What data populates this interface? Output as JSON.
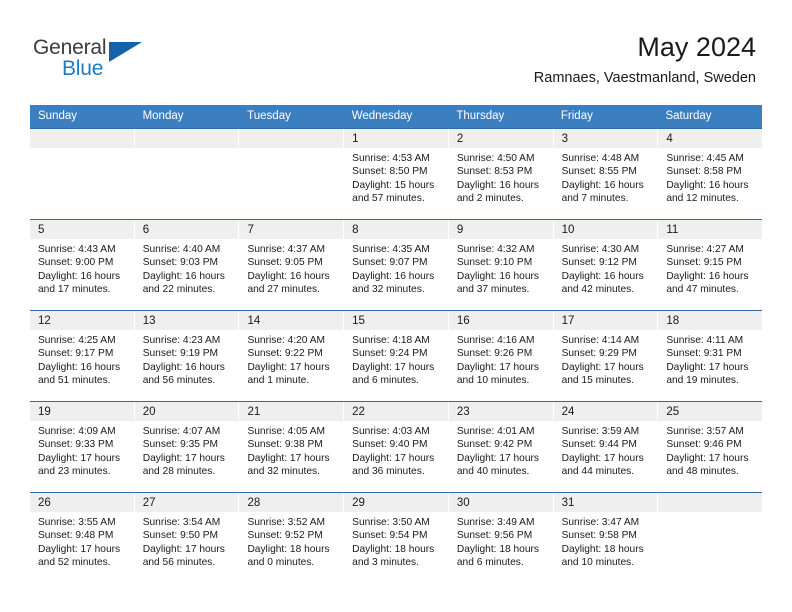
{
  "brand": {
    "name_top": "General",
    "name_bottom": "Blue",
    "triangle_icon": "triangle-icon",
    "colors": {
      "general_text": "#3c3c3c",
      "blue_text": "#1f7bc1",
      "triangle": "#1263a8"
    }
  },
  "header": {
    "title": "May 2024",
    "subtitle": "Ramnaes, Vaestmanland, Sweden"
  },
  "colors": {
    "header_band": "#3c7fc1",
    "row_divider": "#2e6da4",
    "day_number_band": "#efefef",
    "cell_background": "#ffffff"
  },
  "weekdays": [
    "Sunday",
    "Monday",
    "Tuesday",
    "Wednesday",
    "Thursday",
    "Friday",
    "Saturday"
  ],
  "weeks": [
    [
      {
        "day": "",
        "empty": true,
        "sunrise": "",
        "sunset": "",
        "daylight": ""
      },
      {
        "day": "",
        "empty": true,
        "sunrise": "",
        "sunset": "",
        "daylight": ""
      },
      {
        "day": "",
        "empty": true,
        "sunrise": "",
        "sunset": "",
        "daylight": ""
      },
      {
        "day": "1",
        "empty": false,
        "sunrise": "Sunrise: 4:53 AM",
        "sunset": "Sunset: 8:50 PM",
        "daylight": "Daylight: 15 hours and 57 minutes."
      },
      {
        "day": "2",
        "empty": false,
        "sunrise": "Sunrise: 4:50 AM",
        "sunset": "Sunset: 8:53 PM",
        "daylight": "Daylight: 16 hours and 2 minutes."
      },
      {
        "day": "3",
        "empty": false,
        "sunrise": "Sunrise: 4:48 AM",
        "sunset": "Sunset: 8:55 PM",
        "daylight": "Daylight: 16 hours and 7 minutes."
      },
      {
        "day": "4",
        "empty": false,
        "sunrise": "Sunrise: 4:45 AM",
        "sunset": "Sunset: 8:58 PM",
        "daylight": "Daylight: 16 hours and 12 minutes."
      }
    ],
    [
      {
        "day": "5",
        "empty": false,
        "sunrise": "Sunrise: 4:43 AM",
        "sunset": "Sunset: 9:00 PM",
        "daylight": "Daylight: 16 hours and 17 minutes."
      },
      {
        "day": "6",
        "empty": false,
        "sunrise": "Sunrise: 4:40 AM",
        "sunset": "Sunset: 9:03 PM",
        "daylight": "Daylight: 16 hours and 22 minutes."
      },
      {
        "day": "7",
        "empty": false,
        "sunrise": "Sunrise: 4:37 AM",
        "sunset": "Sunset: 9:05 PM",
        "daylight": "Daylight: 16 hours and 27 minutes."
      },
      {
        "day": "8",
        "empty": false,
        "sunrise": "Sunrise: 4:35 AM",
        "sunset": "Sunset: 9:07 PM",
        "daylight": "Daylight: 16 hours and 32 minutes."
      },
      {
        "day": "9",
        "empty": false,
        "sunrise": "Sunrise: 4:32 AM",
        "sunset": "Sunset: 9:10 PM",
        "daylight": "Daylight: 16 hours and 37 minutes."
      },
      {
        "day": "10",
        "empty": false,
        "sunrise": "Sunrise: 4:30 AM",
        "sunset": "Sunset: 9:12 PM",
        "daylight": "Daylight: 16 hours and 42 minutes."
      },
      {
        "day": "11",
        "empty": false,
        "sunrise": "Sunrise: 4:27 AM",
        "sunset": "Sunset: 9:15 PM",
        "daylight": "Daylight: 16 hours and 47 minutes."
      }
    ],
    [
      {
        "day": "12",
        "empty": false,
        "sunrise": "Sunrise: 4:25 AM",
        "sunset": "Sunset: 9:17 PM",
        "daylight": "Daylight: 16 hours and 51 minutes."
      },
      {
        "day": "13",
        "empty": false,
        "sunrise": "Sunrise: 4:23 AM",
        "sunset": "Sunset: 9:19 PM",
        "daylight": "Daylight: 16 hours and 56 minutes."
      },
      {
        "day": "14",
        "empty": false,
        "sunrise": "Sunrise: 4:20 AM",
        "sunset": "Sunset: 9:22 PM",
        "daylight": "Daylight: 17 hours and 1 minute."
      },
      {
        "day": "15",
        "empty": false,
        "sunrise": "Sunrise: 4:18 AM",
        "sunset": "Sunset: 9:24 PM",
        "daylight": "Daylight: 17 hours and 6 minutes."
      },
      {
        "day": "16",
        "empty": false,
        "sunrise": "Sunrise: 4:16 AM",
        "sunset": "Sunset: 9:26 PM",
        "daylight": "Daylight: 17 hours and 10 minutes."
      },
      {
        "day": "17",
        "empty": false,
        "sunrise": "Sunrise: 4:14 AM",
        "sunset": "Sunset: 9:29 PM",
        "daylight": "Daylight: 17 hours and 15 minutes."
      },
      {
        "day": "18",
        "empty": false,
        "sunrise": "Sunrise: 4:11 AM",
        "sunset": "Sunset: 9:31 PM",
        "daylight": "Daylight: 17 hours and 19 minutes."
      }
    ],
    [
      {
        "day": "19",
        "empty": false,
        "sunrise": "Sunrise: 4:09 AM",
        "sunset": "Sunset: 9:33 PM",
        "daylight": "Daylight: 17 hours and 23 minutes."
      },
      {
        "day": "20",
        "empty": false,
        "sunrise": "Sunrise: 4:07 AM",
        "sunset": "Sunset: 9:35 PM",
        "daylight": "Daylight: 17 hours and 28 minutes."
      },
      {
        "day": "21",
        "empty": false,
        "sunrise": "Sunrise: 4:05 AM",
        "sunset": "Sunset: 9:38 PM",
        "daylight": "Daylight: 17 hours and 32 minutes."
      },
      {
        "day": "22",
        "empty": false,
        "sunrise": "Sunrise: 4:03 AM",
        "sunset": "Sunset: 9:40 PM",
        "daylight": "Daylight: 17 hours and 36 minutes."
      },
      {
        "day": "23",
        "empty": false,
        "sunrise": "Sunrise: 4:01 AM",
        "sunset": "Sunset: 9:42 PM",
        "daylight": "Daylight: 17 hours and 40 minutes."
      },
      {
        "day": "24",
        "empty": false,
        "sunrise": "Sunrise: 3:59 AM",
        "sunset": "Sunset: 9:44 PM",
        "daylight": "Daylight: 17 hours and 44 minutes."
      },
      {
        "day": "25",
        "empty": false,
        "sunrise": "Sunrise: 3:57 AM",
        "sunset": "Sunset: 9:46 PM",
        "daylight": "Daylight: 17 hours and 48 minutes."
      }
    ],
    [
      {
        "day": "26",
        "empty": false,
        "sunrise": "Sunrise: 3:55 AM",
        "sunset": "Sunset: 9:48 PM",
        "daylight": "Daylight: 17 hours and 52 minutes."
      },
      {
        "day": "27",
        "empty": false,
        "sunrise": "Sunrise: 3:54 AM",
        "sunset": "Sunset: 9:50 PM",
        "daylight": "Daylight: 17 hours and 56 minutes."
      },
      {
        "day": "28",
        "empty": false,
        "sunrise": "Sunrise: 3:52 AM",
        "sunset": "Sunset: 9:52 PM",
        "daylight": "Daylight: 18 hours and 0 minutes."
      },
      {
        "day": "29",
        "empty": false,
        "sunrise": "Sunrise: 3:50 AM",
        "sunset": "Sunset: 9:54 PM",
        "daylight": "Daylight: 18 hours and 3 minutes."
      },
      {
        "day": "30",
        "empty": false,
        "sunrise": "Sunrise: 3:49 AM",
        "sunset": "Sunset: 9:56 PM",
        "daylight": "Daylight: 18 hours and 6 minutes."
      },
      {
        "day": "31",
        "empty": false,
        "sunrise": "Sunrise: 3:47 AM",
        "sunset": "Sunset: 9:58 PM",
        "daylight": "Daylight: 18 hours and 10 minutes."
      },
      {
        "day": "",
        "empty": true,
        "sunrise": "",
        "sunset": "",
        "daylight": ""
      }
    ]
  ]
}
